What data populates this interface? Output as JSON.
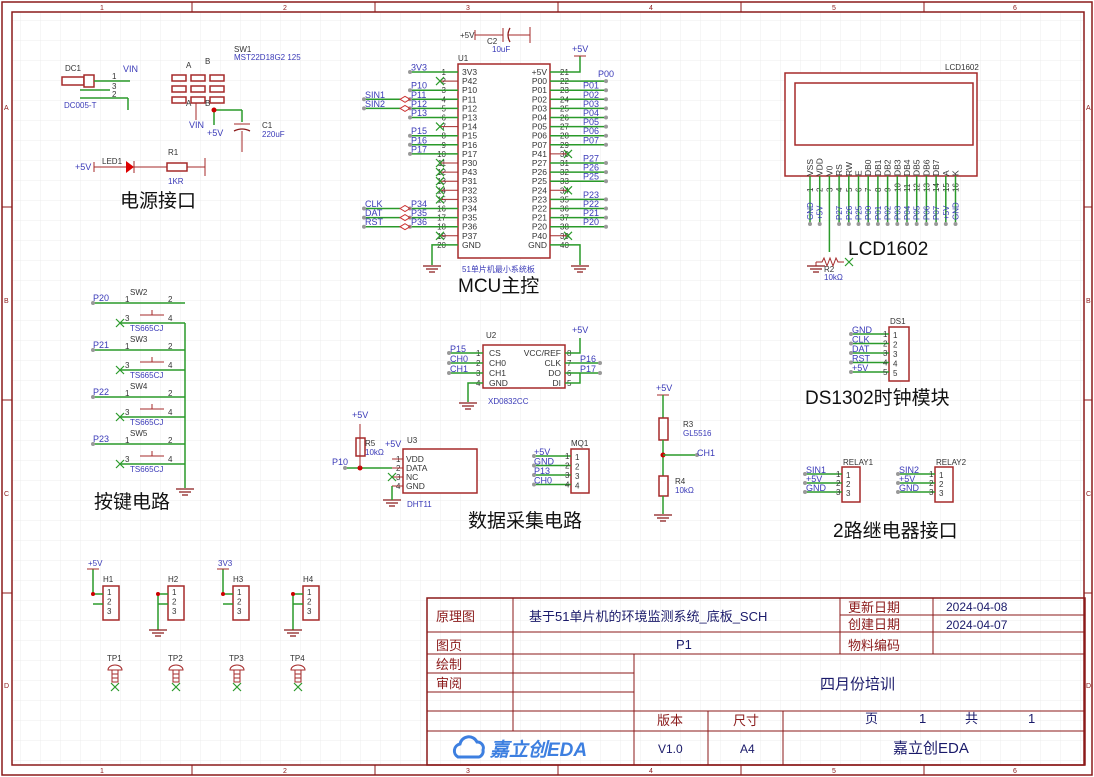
{
  "colors": {
    "frame": "#8b1a1a",
    "wire": "#2a9a2a",
    "net_label": "#3a3ab8",
    "component": "#a52a2a"
  },
  "ruler": {
    "columns": [
      "1",
      "2",
      "3",
      "4",
      "5",
      "6"
    ],
    "rows": [
      "A",
      "B",
      "C",
      "D"
    ]
  },
  "sections": {
    "power": "电源接口",
    "mcu": "MCU主控",
    "lcd": "LCD1602",
    "keys": "按键电路",
    "rtc": "DS1302时钟模块",
    "sensors": "数据采集电路",
    "relay": "2路继电器接口"
  },
  "power": {
    "dc1": {
      "des": "DC1",
      "val": "DC005-T",
      "pins": [
        "1",
        "3",
        "2"
      ],
      "net": "VIN"
    },
    "sw1": {
      "des": "SW1",
      "val": "MST22D18G2 125",
      "labels": [
        "A",
        "B",
        "A",
        "B"
      ],
      "net_vin": "VIN",
      "net_5v": "+5V"
    },
    "c1": {
      "des": "C1",
      "val": "220uF"
    },
    "led1": {
      "des": "LED1",
      "net": "+5V"
    },
    "r1": {
      "des": "R1",
      "val": "1KR"
    }
  },
  "c2": {
    "des": "C2",
    "val": "10uF",
    "net": "+5V"
  },
  "u1": {
    "des": "U1",
    "val": "51单片机最小系统板",
    "net_5v": "+5V",
    "left_pins": [
      [
        "1",
        "3V3",
        "3V3",
        ""
      ],
      [
        "2",
        "P42",
        "",
        "nc"
      ],
      [
        "3",
        "P10",
        "P10",
        ""
      ],
      [
        "4",
        "P11",
        "P11",
        "SIN1"
      ],
      [
        "5",
        "P12",
        "P12",
        "SIN2"
      ],
      [
        "6",
        "P13",
        "P13",
        ""
      ],
      [
        "7",
        "P14",
        "",
        "nc"
      ],
      [
        "8",
        "P15",
        "P15",
        ""
      ],
      [
        "9",
        "P16",
        "P16",
        ""
      ],
      [
        "10",
        "P17",
        "P17",
        ""
      ],
      [
        "11",
        "P30",
        "",
        "nc"
      ],
      [
        "12",
        "P43",
        "",
        "nc"
      ],
      [
        "13",
        "P31",
        "",
        "nc"
      ],
      [
        "14",
        "P32",
        "",
        "nc"
      ],
      [
        "15",
        "P33",
        "",
        "nc"
      ],
      [
        "16",
        "P34",
        "P34",
        "CLK"
      ],
      [
        "17",
        "P35",
        "P35",
        "DAT"
      ],
      [
        "18",
        "P36",
        "P36",
        "RST"
      ],
      [
        "19",
        "P37",
        "",
        "nc"
      ],
      [
        "20",
        "GND",
        "",
        ""
      ]
    ],
    "right_pins": [
      [
        "21",
        "+5V",
        "",
        ""
      ],
      [
        "22",
        "P00",
        "P00",
        ""
      ],
      [
        "23",
        "P01",
        "P01",
        ""
      ],
      [
        "24",
        "P02",
        "P02",
        ""
      ],
      [
        "25",
        "P03",
        "P03",
        ""
      ],
      [
        "26",
        "P04",
        "P04",
        ""
      ],
      [
        "27",
        "P05",
        "P05",
        ""
      ],
      [
        "28",
        "P06",
        "P06",
        ""
      ],
      [
        "29",
        "P07",
        "P07",
        ""
      ],
      [
        "30",
        "P41",
        "",
        "nc"
      ],
      [
        "31",
        "P27",
        "P27",
        ""
      ],
      [
        "32",
        "P26",
        "P26",
        ""
      ],
      [
        "33",
        "P25",
        "P25",
        ""
      ],
      [
        "34",
        "P24",
        "",
        "nc"
      ],
      [
        "35",
        "P23",
        "P23",
        ""
      ],
      [
        "36",
        "P22",
        "P22",
        ""
      ],
      [
        "37",
        "P21",
        "P21",
        ""
      ],
      [
        "38",
        "P20",
        "P20",
        ""
      ],
      [
        "39",
        "P40",
        "",
        "nc"
      ],
      [
        "40",
        "GND",
        "",
        ""
      ]
    ]
  },
  "lcd": {
    "des": "LCD1602",
    "pins": [
      [
        "1",
        "VSS",
        "GND"
      ],
      [
        "2",
        "VDD",
        "+5V"
      ],
      [
        "3",
        "V0",
        ""
      ],
      [
        "4",
        "RS",
        "P27"
      ],
      [
        "5",
        "RW",
        "P26"
      ],
      [
        "6",
        "E",
        "P25"
      ],
      [
        "7",
        "DB0",
        "P00"
      ],
      [
        "8",
        "DB1",
        "P01"
      ],
      [
        "9",
        "DB2",
        "P02"
      ],
      [
        "10",
        "DB3",
        "P03"
      ],
      [
        "11",
        "DB4",
        "P04"
      ],
      [
        "12",
        "DB5",
        "P05"
      ],
      [
        "13",
        "DB6",
        "P06"
      ],
      [
        "14",
        "DB7",
        "P07"
      ],
      [
        "15",
        "A",
        "+5V"
      ],
      [
        "16",
        "K",
        "GND"
      ]
    ],
    "r2": {
      "des": "R2",
      "val": "10kΩ"
    }
  },
  "switches": [
    {
      "des": "SW2",
      "val": "TS665CJ",
      "net": "P20"
    },
    {
      "des": "SW3",
      "val": "TS665CJ",
      "net": "P21"
    },
    {
      "des": "SW4",
      "val": "TS665CJ",
      "net": "P22"
    },
    {
      "des": "SW5",
      "val": "TS665CJ",
      "net": "P23"
    }
  ],
  "switch_pins": [
    "1",
    "2",
    "3",
    "4"
  ],
  "u2": {
    "des": "U2",
    "val": "XD0832CC",
    "net_5v": "+5V",
    "left": [
      [
        "1",
        "CS",
        "P15"
      ],
      [
        "2",
        "CH0",
        "CH0"
      ],
      [
        "3",
        "CH1",
        "CH1"
      ],
      [
        "4",
        "GND",
        ""
      ]
    ],
    "right": [
      [
        "8",
        "VCC/REF",
        ""
      ],
      [
        "7",
        "CLK",
        "P16"
      ],
      [
        "6",
        "DO",
        "P17"
      ],
      [
        "5",
        "DI",
        ""
      ]
    ]
  },
  "u3": {
    "des": "U3",
    "val": "DHT11",
    "net_5v": "+5V",
    "net_p10": "P10",
    "pins": [
      [
        "1",
        "VDD"
      ],
      [
        "2",
        "DATA"
      ],
      [
        "3",
        "NC"
      ],
      [
        "4",
        "GND"
      ]
    ],
    "r5": {
      "des": "R5",
      "val": "10kΩ",
      "net": "+5V"
    }
  },
  "mq1": {
    "des": "MQ1",
    "pins": [
      [
        "1",
        "+5V"
      ],
      [
        "2",
        "GND"
      ],
      [
        "3",
        "P13"
      ],
      [
        "4",
        "CH0"
      ]
    ]
  },
  "r3": {
    "des": "R3",
    "val": "GL5516",
    "net": "+5V",
    "out": "CH1"
  },
  "r4": {
    "des": "R4",
    "val": "10kΩ"
  },
  "ds1": {
    "des": "DS1",
    "pins": [
      [
        "1",
        "GND"
      ],
      [
        "2",
        "CLK"
      ],
      [
        "3",
        "DAT"
      ],
      [
        "4",
        "RST"
      ],
      [
        "5",
        "+5V"
      ]
    ]
  },
  "relays": [
    {
      "des": "RELAY1",
      "pins": [
        [
          "1",
          "SIN1"
        ],
        [
          "2",
          "+5V"
        ],
        [
          "3",
          "GND"
        ]
      ]
    },
    {
      "des": "RELAY2",
      "pins": [
        [
          "1",
          "SIN2"
        ],
        [
          "2",
          "+5V"
        ],
        [
          "3",
          "GND"
        ]
      ]
    }
  ],
  "headers": [
    {
      "des": "H1",
      "net": "+5V"
    },
    {
      "des": "H2",
      "net": ""
    },
    {
      "des": "H3",
      "net": "3V3"
    },
    {
      "des": "H4",
      "net": ""
    }
  ],
  "header_pins": [
    "1",
    "2",
    "3"
  ],
  "test_points": [
    "TP1",
    "TP2",
    "TP3",
    "TP4"
  ],
  "title_block": {
    "type_label": "原理图",
    "title": "基于51单片机的环境监测系统_底板_SCH",
    "update_label": "更新日期",
    "update_date": "2024-04-08",
    "create_label": "创建日期",
    "create_date": "2024-04-07",
    "page_label": "图页",
    "page_value": "P1",
    "part_label": "物料编码",
    "draw_label": "绘制",
    "review_label": "审阅",
    "project": "四月份培训",
    "version_label": "版本",
    "version": "V1.0",
    "size_label": "尺寸",
    "size": "A4",
    "sheet_label": "页",
    "sheet": "1",
    "total_label": "共",
    "total": "1",
    "logo": "嘉立创EDA",
    "company": "嘉立创EDA"
  }
}
